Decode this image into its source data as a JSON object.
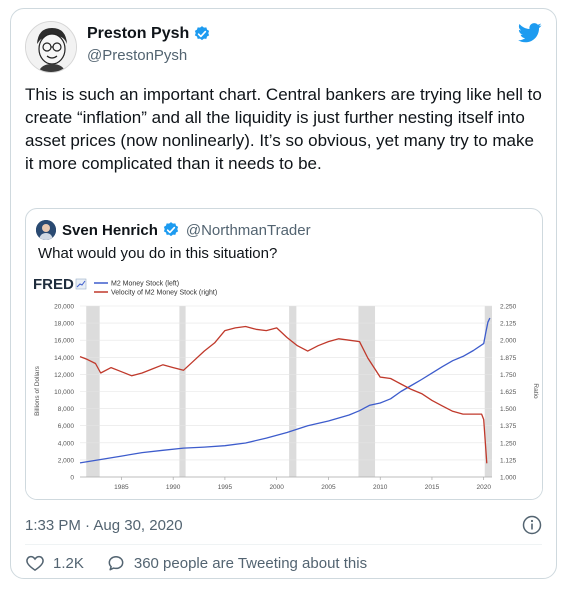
{
  "tweet": {
    "author_name": "Preston Pysh",
    "author_handle": "@PrestonPysh",
    "text": "This is such an important chart.  Central bankers are trying like hell to create “inflation” and all the liquidity is just further nesting itself into asset prices (now nonlinearly).  It’s so obvious, yet many try to make it more complicated than it needs to be.",
    "timestamp": "1:33 PM · Aug 30, 2020",
    "likes": "1.2K",
    "discussion": "360 people are Tweeting about this"
  },
  "quote": {
    "author_name": "Sven Henrich",
    "author_handle": "@NorthmanTrader",
    "text": "What would you do in this situation?"
  },
  "colors": {
    "twitter_blue": "#1d9bf0",
    "m2_line": "#3d5ccc",
    "velocity_line": "#c0392b",
    "recession_shading": "#dcdcdc"
  },
  "chart_data": {
    "type": "line",
    "brand": "FRED",
    "legend": [
      "M2 Money Stock (left)",
      "Velocity of M2 Money Stock (right)"
    ],
    "ylabel": "Billions of Dollars",
    "y2label": "Ratio",
    "xlim": [
      1981,
      2020.8
    ],
    "ylim": [
      0,
      20000
    ],
    "y2lim": [
      1.0,
      2.25
    ],
    "x_ticks": [
      "1985",
      "1990",
      "1995",
      "2000",
      "2005",
      "2010",
      "2015",
      "2020"
    ],
    "y_ticks": [
      "0",
      "2,000",
      "4,000",
      "6,000",
      "8,000",
      "10,000",
      "12,000",
      "14,000",
      "16,000",
      "18,000",
      "20,000"
    ],
    "y2_ticks": [
      "1.000",
      "1.125",
      "1.250",
      "1.375",
      "1.500",
      "1.625",
      "1.750",
      "1.875",
      "2.000",
      "2.125",
      "2.250"
    ],
    "recessions": [
      [
        1981.6,
        1982.9
      ],
      [
        1990.6,
        1991.2
      ],
      [
        2001.2,
        2001.9
      ],
      [
        2007.9,
        2009.5
      ],
      [
        2020.1,
        2020.8
      ]
    ],
    "series": [
      {
        "name": "M2 Money Stock (left)",
        "color": "#3d5ccc",
        "axis": "left",
        "x": [
          1981,
          1983,
          1985,
          1987,
          1989,
          1991,
          1993,
          1995,
          1997,
          1999,
          2001,
          2003,
          2005,
          2007,
          2008,
          2009,
          2010,
          2011,
          2012,
          2013,
          2014,
          2015,
          2016,
          2017,
          2018,
          2019,
          2020,
          2020.2,
          2020.4,
          2020.6
        ],
        "values": [
          1650,
          2050,
          2450,
          2850,
          3120,
          3380,
          3500,
          3660,
          3980,
          4550,
          5200,
          6000,
          6550,
          7250,
          7750,
          8400,
          8650,
          9150,
          10000,
          10700,
          11400,
          12150,
          12900,
          13600,
          14100,
          14800,
          15600,
          16900,
          18100,
          18600
        ]
      },
      {
        "name": "Velocity of M2 Money Stock (right)",
        "color": "#c0392b",
        "axis": "right",
        "x": [
          1981,
          1981.7,
          1982.5,
          1983,
          1984,
          1985,
          1986,
          1987,
          1988,
          1989,
          1990,
          1991,
          1992,
          1993,
          1994,
          1995,
          1996,
          1997,
          1998,
          1999,
          2000,
          2001,
          2002,
          2003,
          2004,
          2005,
          2006,
          2007,
          2008,
          2008.8,
          2010,
          2011,
          2012,
          2013,
          2014,
          2015,
          2016,
          2017,
          2018,
          2019,
          2019.8,
          2020,
          2020.3
        ],
        "values": [
          1.88,
          1.86,
          1.83,
          1.76,
          1.8,
          1.77,
          1.74,
          1.76,
          1.79,
          1.82,
          1.8,
          1.78,
          1.85,
          1.92,
          1.98,
          2.07,
          2.09,
          2.1,
          2.08,
          2.07,
          2.09,
          2.02,
          1.96,
          1.92,
          1.96,
          1.99,
          2.01,
          2.0,
          1.99,
          1.87,
          1.73,
          1.72,
          1.68,
          1.64,
          1.61,
          1.56,
          1.52,
          1.48,
          1.46,
          1.46,
          1.46,
          1.42,
          1.1
        ]
      }
    ]
  }
}
